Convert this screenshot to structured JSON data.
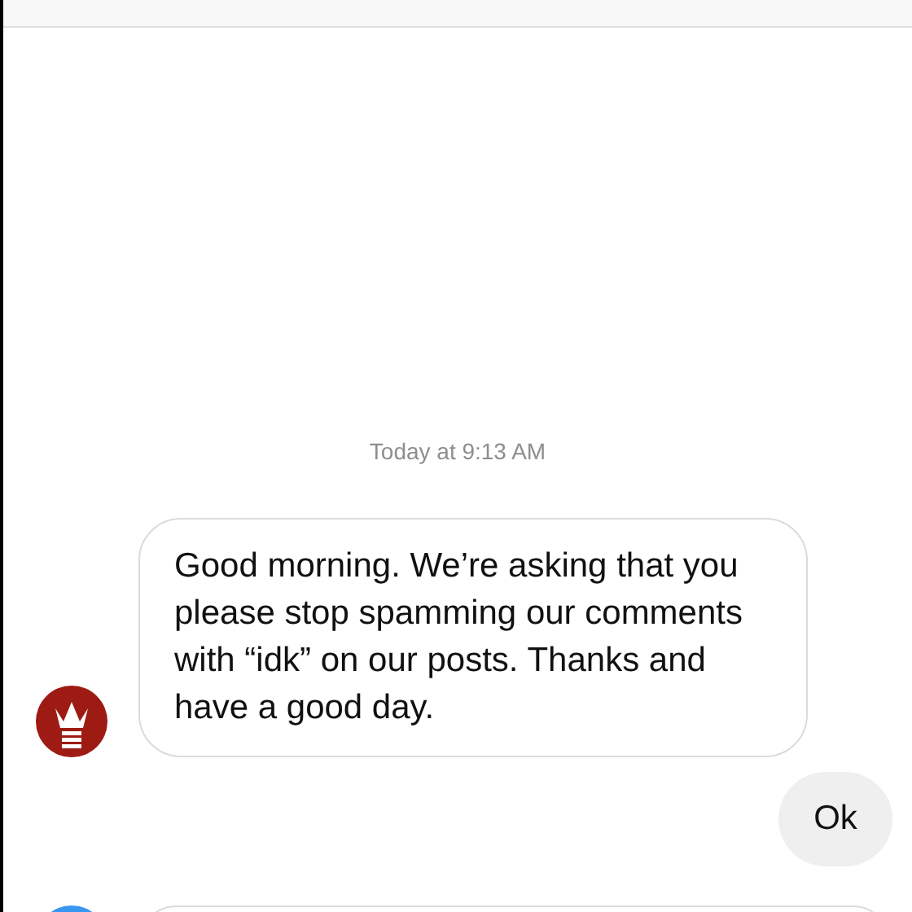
{
  "thread": {
    "timestamp": "Today at 9:13 AM",
    "messages": [
      {
        "kind": "received",
        "text": "Good morning. We’re asking that you please stop spamming our comments with “idk” on our posts. Thanks and have a good day."
      },
      {
        "kind": "sent",
        "text": "Ok"
      }
    ]
  }
}
